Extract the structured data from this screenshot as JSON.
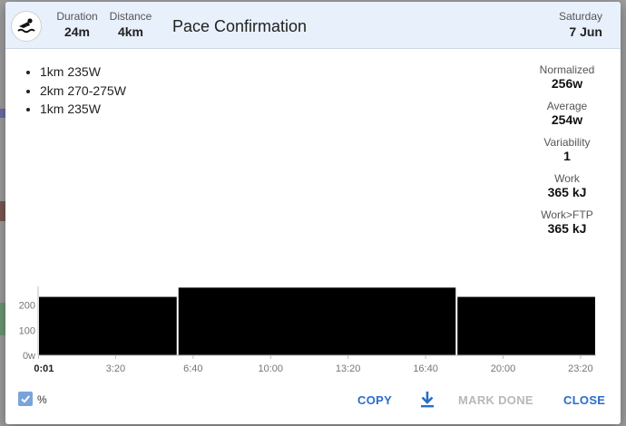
{
  "header": {
    "sport_icon": "swimmer-icon",
    "duration_label": "Duration",
    "duration_value": "24m",
    "distance_label": "Distance",
    "distance_value": "4km",
    "title": "Pace Confirmation",
    "day_of_week": "Saturday",
    "date": "7 Jun"
  },
  "description": {
    "lines": [
      "1km 235W",
      "2km 270-275W",
      "1km 235W"
    ]
  },
  "metrics": [
    {
      "label": "Normalized",
      "value": "256w"
    },
    {
      "label": "Average",
      "value": "254w"
    },
    {
      "label": "Variability",
      "value": "1"
    },
    {
      "label": "Work",
      "value": "365 kJ"
    },
    {
      "label": "Work>FTP",
      "value": "365 kJ"
    }
  ],
  "chart_data": {
    "type": "bar",
    "x_unit": "minutes",
    "xlim": [
      0,
      24
    ],
    "ylim": [
      0,
      275
    ],
    "yticks": [
      {
        "value": 0,
        "label": "0w"
      },
      {
        "value": 100,
        "label": "100"
      },
      {
        "value": 200,
        "label": "200"
      }
    ],
    "xticks": [
      "0:01",
      "3:20",
      "6:40",
      "10:00",
      "13:20",
      "16:40",
      "20:00",
      "23:20"
    ],
    "xtick_values": [
      0.0167,
      3.333,
      6.667,
      10,
      13.333,
      16.667,
      20,
      23.333
    ],
    "segments": [
      {
        "start": 0,
        "end": 6,
        "watts": 235
      },
      {
        "start": 6,
        "end": 18,
        "watts": 272
      },
      {
        "start": 18,
        "end": 24,
        "watts": 235
      }
    ],
    "colors": {
      "bar": "#000000",
      "axis": "#bdbdbd",
      "tick_label": "#757575"
    }
  },
  "footer": {
    "percent_label": "%",
    "percent_checked": true,
    "copy_label": "COPY",
    "download_icon": "download-icon",
    "mark_done_label": "MARK DONE",
    "close_label": "CLOSE"
  }
}
